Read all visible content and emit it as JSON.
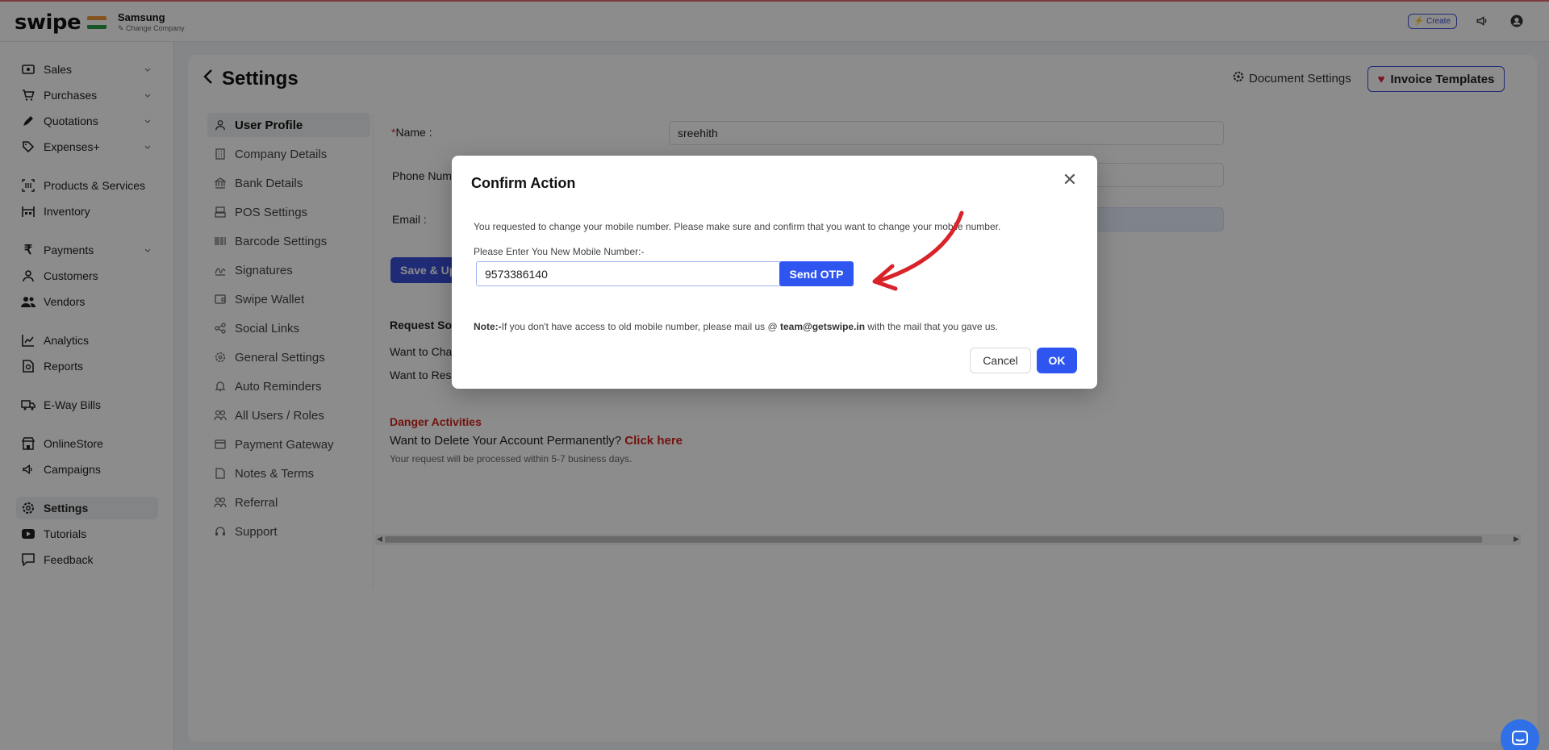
{
  "app": {
    "brand": "swipe",
    "company_name": "Samsung",
    "company_change": "Change Company",
    "create_label": "Create"
  },
  "sidebar": {
    "items": [
      {
        "label": "Sales",
        "icon": "cash-icon",
        "chevron": true
      },
      {
        "label": "Purchases",
        "icon": "cart-icon",
        "chevron": true
      },
      {
        "label": "Quotations",
        "icon": "pen-icon",
        "chevron": true
      },
      {
        "label": "Expenses+",
        "icon": "tag-icon",
        "chevron": true
      },
      {
        "label": "Products & Services",
        "icon": "barcode-icon",
        "chevron": false
      },
      {
        "label": "Inventory",
        "icon": "inventory-icon",
        "chevron": false
      },
      {
        "label": "Payments",
        "icon": "rupee-icon",
        "chevron": true
      },
      {
        "label": "Customers",
        "icon": "user-icon",
        "chevron": false
      },
      {
        "label": "Vendors",
        "icon": "users-icon",
        "chevron": false
      },
      {
        "label": "Analytics",
        "icon": "chart-icon",
        "chevron": false
      },
      {
        "label": "Reports",
        "icon": "report-icon",
        "chevron": false
      },
      {
        "label": "E-Way Bills",
        "icon": "truck-icon",
        "chevron": false
      },
      {
        "label": "OnlineStore",
        "icon": "store-icon",
        "chevron": false
      },
      {
        "label": "Campaigns",
        "icon": "megaphone-icon",
        "chevron": false
      },
      {
        "label": "Settings",
        "icon": "gear-icon",
        "chevron": false,
        "active": true
      },
      {
        "label": "Tutorials",
        "icon": "youtube-icon",
        "chevron": false
      },
      {
        "label": "Feedback",
        "icon": "comment-icon",
        "chevron": false
      }
    ]
  },
  "page": {
    "title": "Settings",
    "document_settings": "Document Settings",
    "invoice_templates": "Invoice Templates"
  },
  "subnav": {
    "items": [
      {
        "label": "User Profile",
        "icon": "user-icon",
        "active": true
      },
      {
        "label": "Company Details",
        "icon": "building-icon"
      },
      {
        "label": "Bank Details",
        "icon": "bank-icon"
      },
      {
        "label": "POS Settings",
        "icon": "pos-icon"
      },
      {
        "label": "Barcode Settings",
        "icon": "barcode-icon"
      },
      {
        "label": "Signatures",
        "icon": "signature-icon"
      },
      {
        "label": "Swipe Wallet",
        "icon": "wallet-icon"
      },
      {
        "label": "Social Links",
        "icon": "share-icon"
      },
      {
        "label": "General Settings",
        "icon": "gear-icon"
      },
      {
        "label": "Auto Reminders",
        "icon": "bell-icon"
      },
      {
        "label": "All Users / Roles",
        "icon": "users-icon"
      },
      {
        "label": "Payment Gateway",
        "icon": "card-icon"
      },
      {
        "label": "Notes & Terms",
        "icon": "note-icon"
      },
      {
        "label": "Referral",
        "icon": "referral-icon"
      },
      {
        "label": "Support",
        "icon": "headset-icon"
      }
    ]
  },
  "profile": {
    "name_label": "Name :",
    "name_value": "sreehith",
    "phone_label": "Phone Num",
    "email_label": "Email :",
    "save_label": "Save & Up",
    "request_heading": "Request So",
    "want_change": "Want to Cha",
    "want_reset": "Want to Res",
    "danger_title": "Danger Activities",
    "danger_question": "Want to Delete Your Account Permanently?",
    "danger_link": "Click here",
    "danger_note": "Your request will be processed within 5-7 business days."
  },
  "modal": {
    "title": "Confirm Action",
    "description": "You requested to change your mobile number. Please make sure and confirm that you want to change your mobile number.",
    "input_label": "Please Enter You New Mobile Number:-",
    "input_value": "9573386140",
    "send_otp": "Send OTP",
    "note_prefix": "Note:-",
    "note_text": "If you don't have access to old mobile number, please mail us @",
    "note_email": "team@getswipe.in",
    "note_suffix": "with the mail that you gave us.",
    "cancel": "Cancel",
    "ok": "OK"
  },
  "colors": {
    "primary": "#2f55f0",
    "danger": "#d0231a",
    "arrow": "#d9232b"
  }
}
